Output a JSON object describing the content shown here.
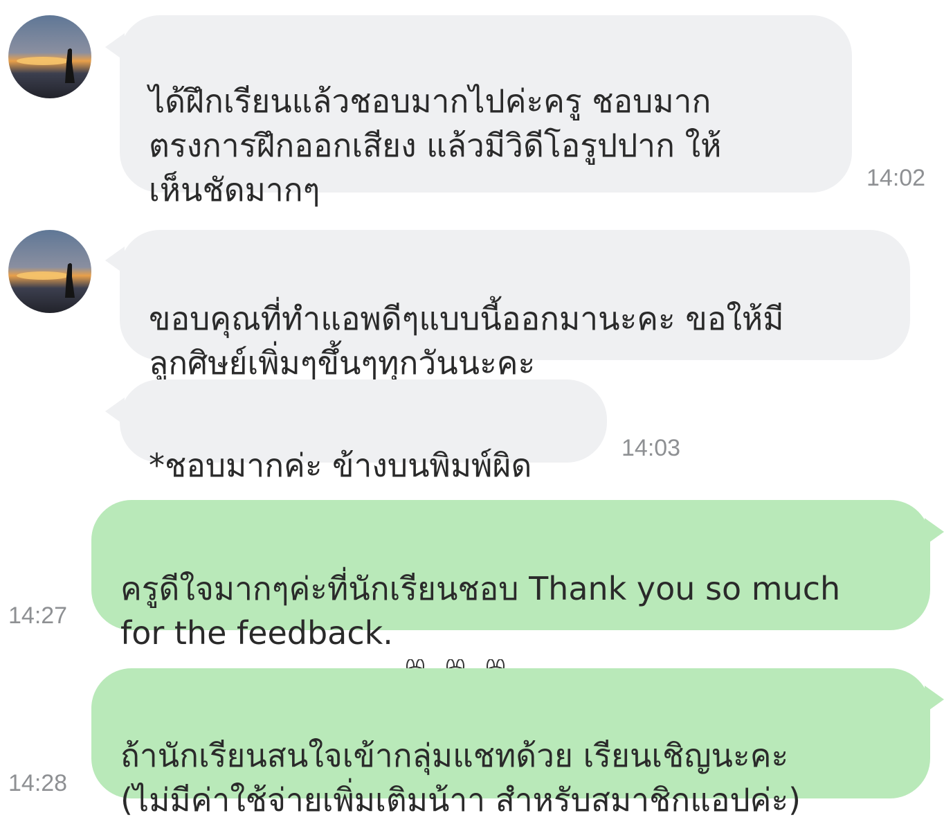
{
  "messages": [
    {
      "direction": "incoming",
      "text": "ได้ฝึกเรียนแล้วชอบมากไปค่ะครู ชอบมาก\nตรงการฝึกออกเสียง แล้วมีวิดีโอรูปปาก ให้\nเห็นชัดมากๆ",
      "time": "14:02"
    },
    {
      "direction": "incoming",
      "text": "ขอบคุณที่ทำแอพดีๆแบบนี้ออกมานะคะ ขอให้มี\nลูกศิษย์เพิ่มๆขึ้นๆทุกวันนะคะ",
      "time": ""
    },
    {
      "direction": "incoming",
      "text": "*ชอบมากค่ะ ข้างบนพิมพ์ผิด",
      "time": "14:03"
    },
    {
      "direction": "outgoing",
      "text": "ครูดีใจมากๆค่ะที่นักเรียนชอบ Thank you so much\nfor the feedback.",
      "stickers": [
        "bunny-kiss-icon",
        "bunny-kiss-icon",
        "bunny-kiss-icon"
      ],
      "time": "14:27"
    },
    {
      "direction": "outgoing",
      "text": "ถ้านักเรียนสนใจเข้ากลุ่มแชทด้วย เรียนเชิญนะคะ\n(ไม่มีค่าใช้จ่ายเพิ่มเติมน้าา สำหรับสมาชิกแอปค่ะ)",
      "time": "14:28"
    }
  ],
  "colors": {
    "incoming_bubble": "#eff0f2",
    "outgoing_bubble": "#b9e9b9",
    "timestamp": "#8e9093",
    "text": "#2a2a2a"
  },
  "icons": {
    "avatar": "sunset-silhouette-avatar",
    "sticker": "bunny-kiss-icon"
  }
}
